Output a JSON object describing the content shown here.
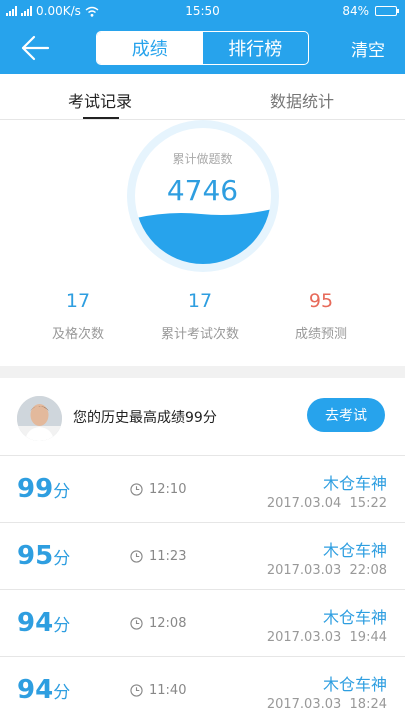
{
  "status_bar": {
    "network_speed": "0.00K/s",
    "time": "15:50",
    "battery": "84%",
    "battery_level": 0.84
  },
  "header": {
    "tabs": [
      {
        "label": "成绩",
        "active": true
      },
      {
        "label": "排行榜",
        "active": false
      }
    ],
    "clear_label": "清空"
  },
  "sub_tabs": [
    {
      "label": "考试记录",
      "active": true
    },
    {
      "label": "数据统计",
      "active": false
    }
  ],
  "gauge": {
    "label": "累计做题数",
    "value": "4746"
  },
  "stats": [
    {
      "value": "17",
      "label": "及格次数",
      "color": "#2e9ee0"
    },
    {
      "value": "17",
      "label": "累计考试次数",
      "color": "#2e9ee0"
    },
    {
      "value": "95",
      "label": "成绩预测",
      "color": "#e76a5a"
    }
  ],
  "best": {
    "text": "您的历史最高成绩99分",
    "button_label": "去考试"
  },
  "records": [
    {
      "score": "99",
      "unit": "分",
      "duration": "12:10",
      "name": "木仓车神",
      "date": "2017.03.04",
      "time": "15:22"
    },
    {
      "score": "95",
      "unit": "分",
      "duration": "11:23",
      "name": "木仓车神",
      "date": "2017.03.03",
      "time": "22:08"
    },
    {
      "score": "94",
      "unit": "分",
      "duration": "12:08",
      "name": "木仓车神",
      "date": "2017.03.03",
      "time": "19:44"
    },
    {
      "score": "94",
      "unit": "分",
      "duration": "11:40",
      "name": "木仓车神",
      "date": "2017.03.03",
      "time": "18:24"
    }
  ],
  "colors": {
    "primary": "#27a3ec",
    "accent_red": "#e76a5a"
  }
}
